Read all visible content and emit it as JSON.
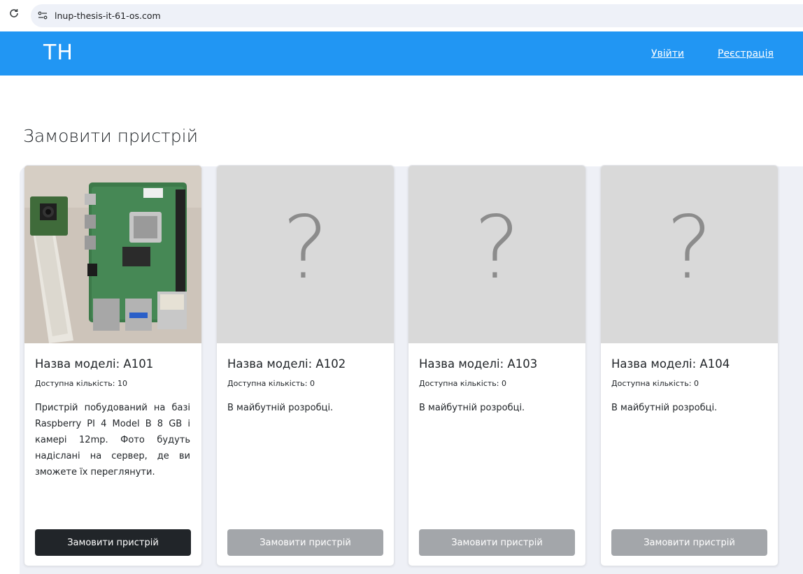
{
  "browser": {
    "url": "lnup-thesis-it-61-os.com"
  },
  "navbar": {
    "brand": "TH",
    "login_label": "Увійти",
    "register_label": "Реєстрація",
    "color": "#2196f3"
  },
  "main": {
    "title": "Замовити пристрій"
  },
  "cards": [
    {
      "title": "Назва моделі: A101",
      "quantity": "Доступна кількість: 10",
      "description": "Пристрій побудований на базі Raspberry PI 4 Model B 8 GB і камері 12mp. Фото будуть надіслані на сервер, де ви зможете їх переглянути.",
      "button_label": "Замовити пристрій",
      "button_state": "active",
      "image": "raspberry-pi-photo"
    },
    {
      "title": "Назва моделі: A102",
      "quantity": "Доступна кількість: 0",
      "description": "В майбутній розробці.",
      "button_label": "Замовити пристрій",
      "button_state": "disabled",
      "image": "placeholder",
      "placeholder_symbol": "?"
    },
    {
      "title": "Назва моделі: A103",
      "quantity": "Доступна кількість: 0",
      "description": "В майбутній розробці.",
      "button_label": "Замовити пристрій",
      "button_state": "disabled",
      "image": "placeholder",
      "placeholder_symbol": "?"
    },
    {
      "title": "Назва моделі: A104",
      "quantity": "Доступна кількість: 0",
      "description": "В майбутній розробці.",
      "button_label": "Замовити пристрій",
      "button_state": "disabled",
      "image": "placeholder",
      "placeholder_symbol": "?"
    }
  ]
}
